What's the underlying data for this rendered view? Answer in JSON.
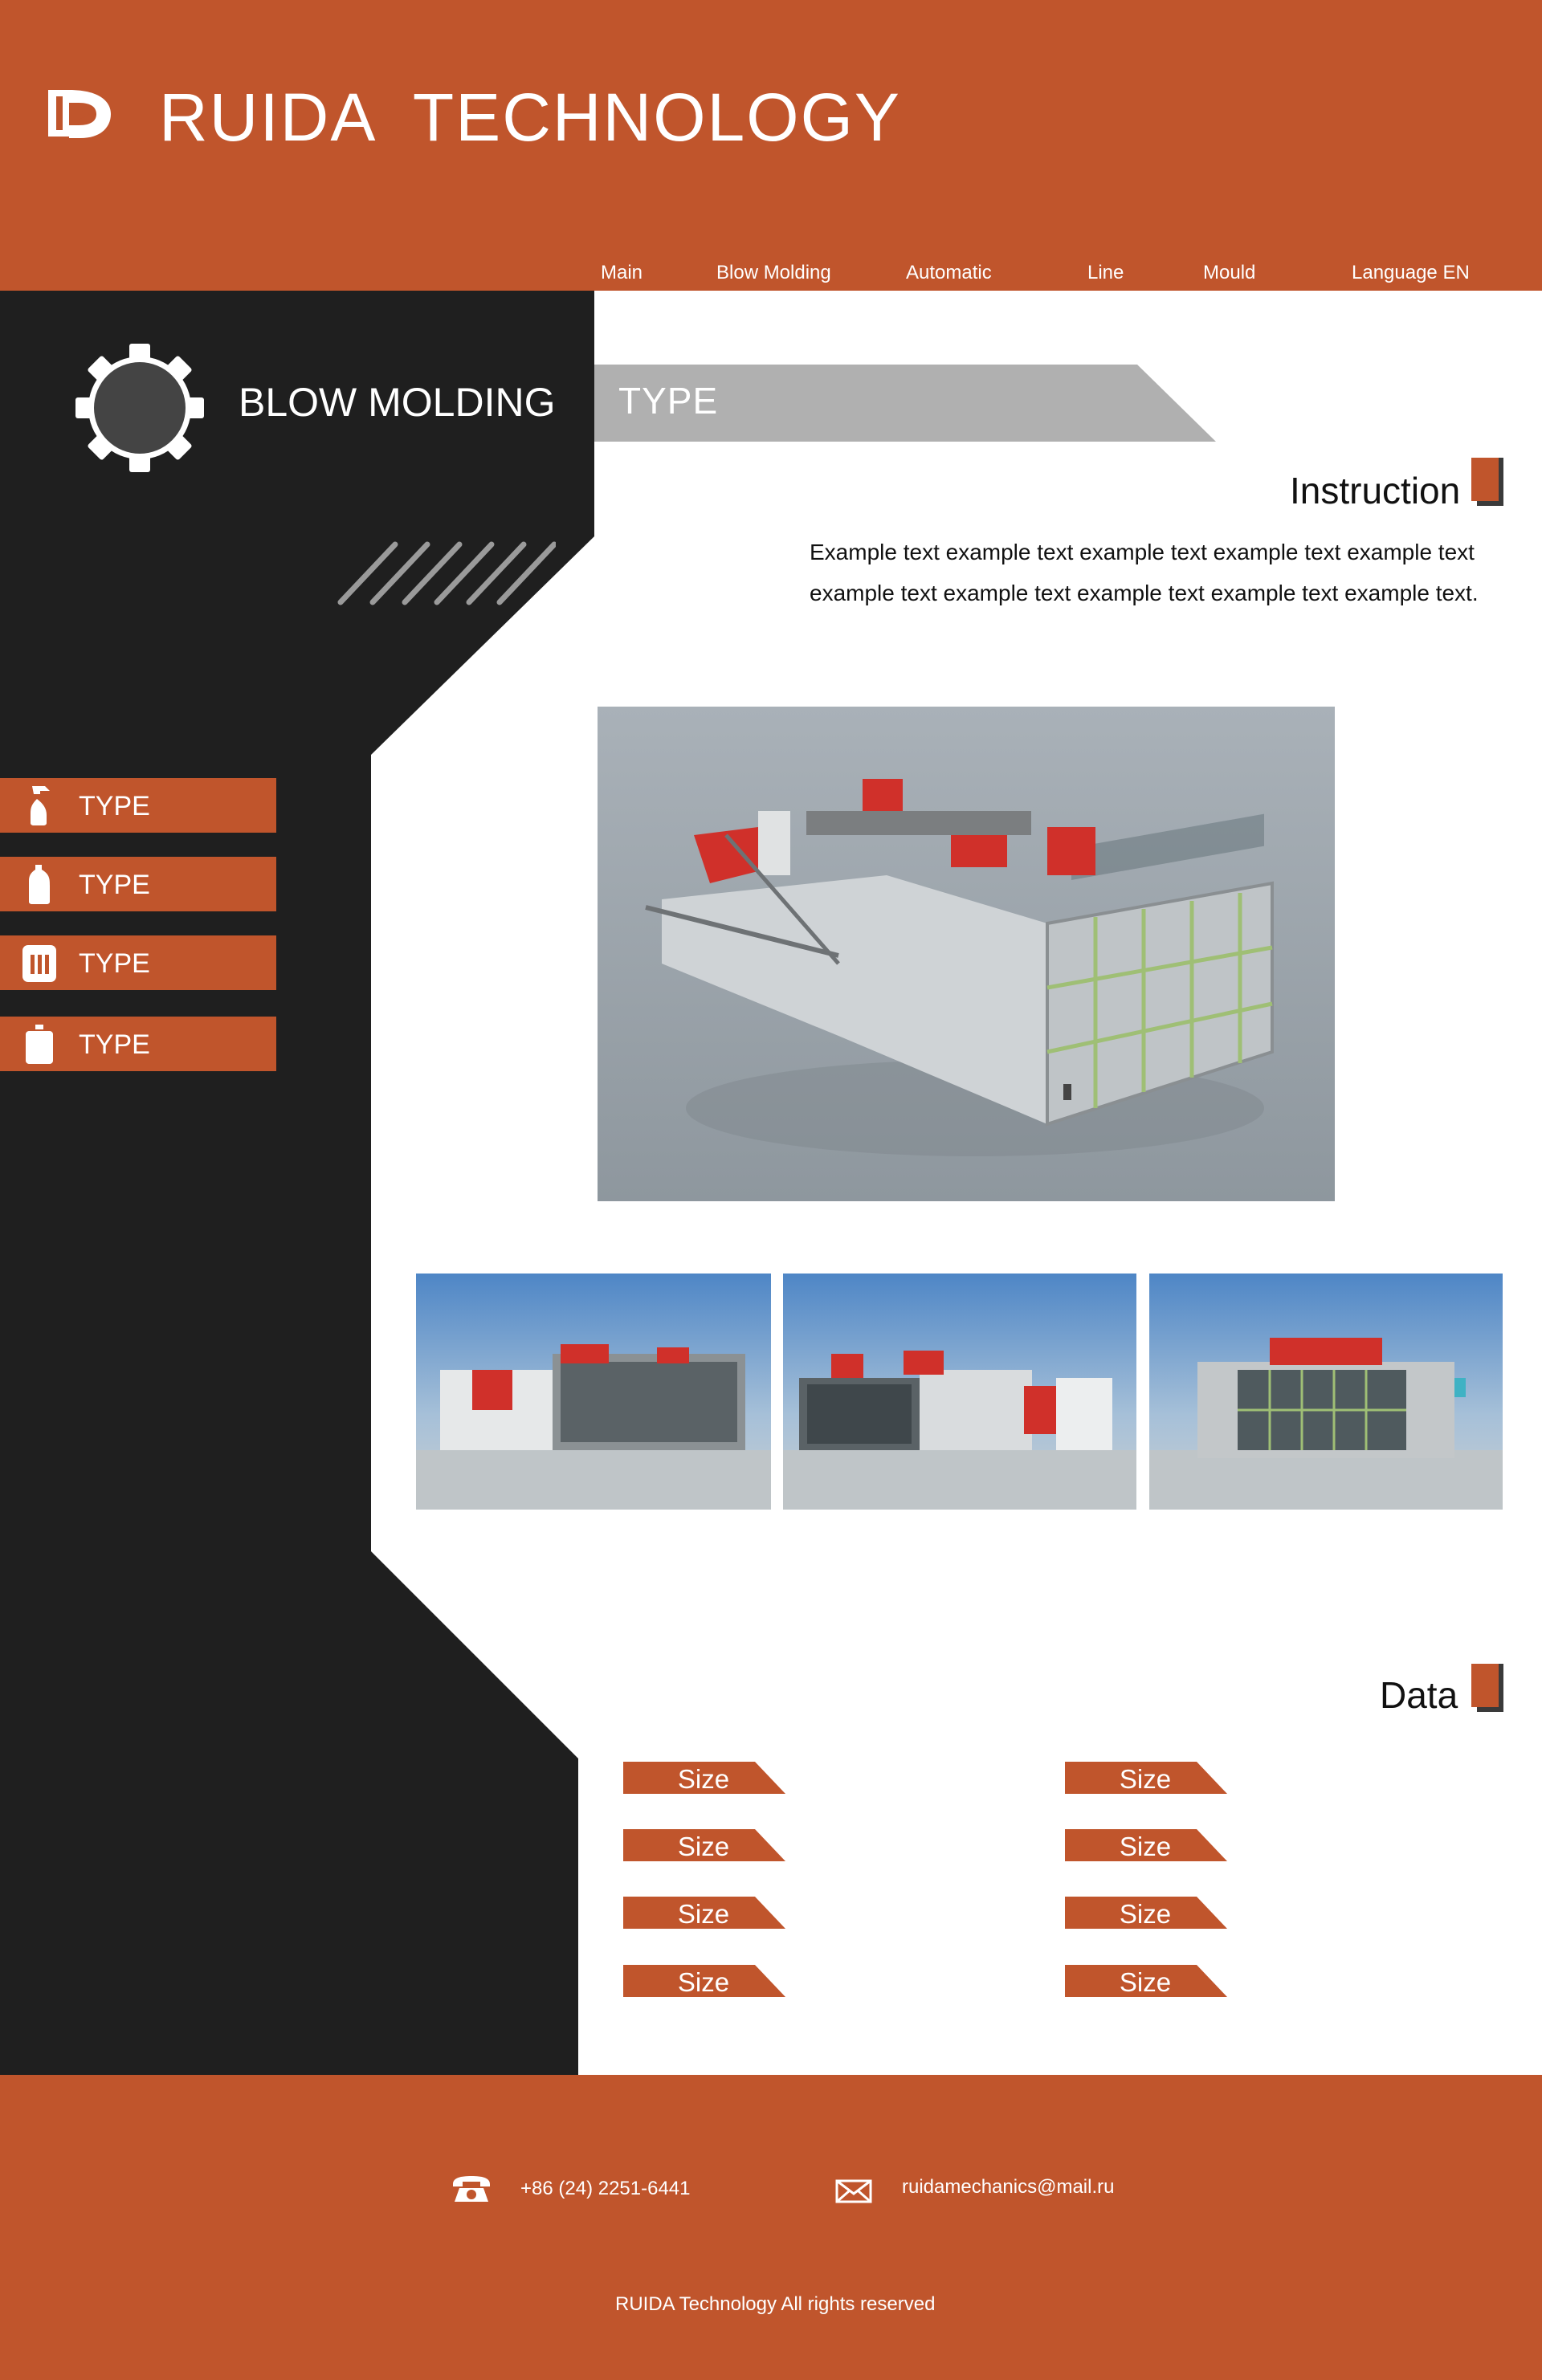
{
  "header": {
    "brand": "RUIDA  TECHNOLOGY",
    "nav": {
      "main": "Main",
      "blow_molding": "Blow Molding",
      "automatic": "Automatic",
      "line": "Line",
      "mould": "Mould",
      "language": "Language  EN"
    }
  },
  "sidebar": {
    "title": "BLOW MOLDING",
    "items": [
      {
        "label": "TYPE",
        "icon": "spray-bottle-icon"
      },
      {
        "label": "TYPE",
        "icon": "detergent-bottle-icon"
      },
      {
        "label": "TYPE",
        "icon": "jerrycan-icon"
      },
      {
        "label": "TYPE",
        "icon": "canister-icon"
      }
    ]
  },
  "main": {
    "tab_label": "TYPE",
    "instruction": {
      "heading": "Instruction",
      "line1": "Example text example text example text example text example text",
      "line2": "example text example text example text example text example text."
    },
    "data": {
      "heading": "Data",
      "left": [
        "Size",
        "Size",
        "Size",
        "Size"
      ],
      "right": [
        "Size",
        "Size",
        "Size",
        "Size"
      ]
    }
  },
  "footer": {
    "phone": "+86 (24)   2251-6441",
    "email": "ruidamechanics@mail.ru",
    "copyright": "RUIDA Technology All rights reserved"
  },
  "colors": {
    "accent": "#c0552c",
    "dark": "#1f1f1f",
    "grey_tab": "#b0b0b0"
  }
}
